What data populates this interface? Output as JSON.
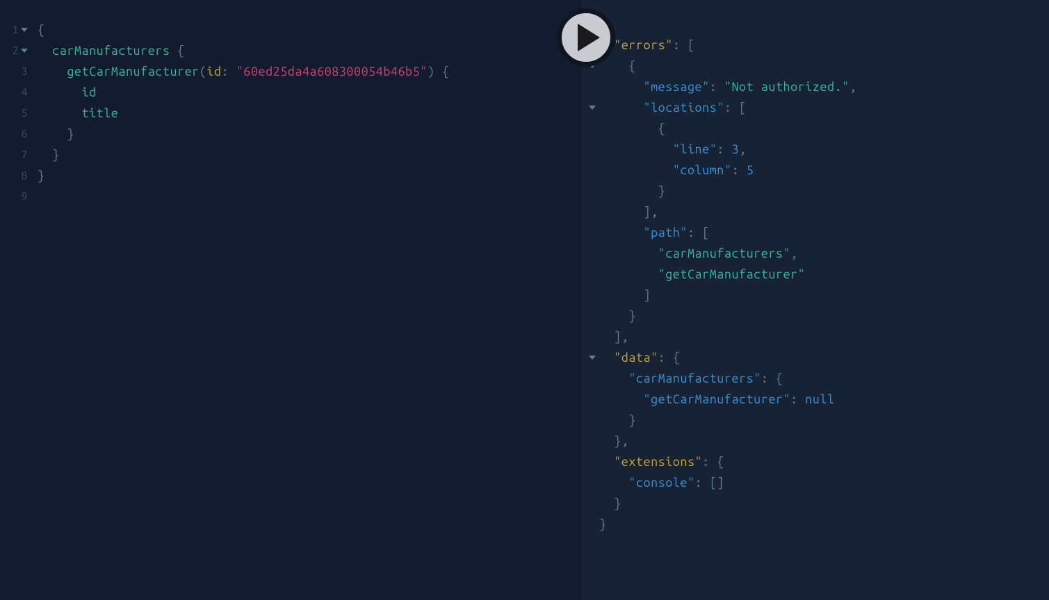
{
  "query": {
    "lines": [
      "1",
      "2",
      "3",
      "4",
      "5",
      "6",
      "7",
      "8",
      "9"
    ],
    "l1_open": "{",
    "l2_field": "carManufacturers",
    "l2_brace": " {",
    "l3_func": "getCarManufacturer",
    "l3_lp": "(",
    "l3_arg": "id",
    "l3_colon": ": ",
    "l3_val": "\"60ed25da4a608300054b46b5\"",
    "l3_rp_brace": ") {",
    "l4_field": "id",
    "l5_field": "title",
    "l6_close": "}",
    "l7_close": "}",
    "l8_close": "}"
  },
  "response": {
    "r1": "{",
    "r2_k": "\"errors\"",
    "r2_p": ": [",
    "r3": "{",
    "r4_k": "\"message\"",
    "r4_p": ": ",
    "r4_v": "\"Not authorized.\"",
    "r4_c": ",",
    "r5_k": "\"locations\"",
    "r5_p": ": [",
    "r6": "{",
    "r7_k": "\"line\"",
    "r7_p": ": ",
    "r7_v": "3",
    "r7_c": ",",
    "r8_k": "\"column\"",
    "r8_p": ": ",
    "r8_v": "5",
    "r9": "}",
    "r10": "],",
    "r11_k": "\"path\"",
    "r11_p": ": [",
    "r12_v": "\"carManufacturers\"",
    "r12_c": ",",
    "r13_v": "\"getCarManufacturer\"",
    "r14": "]",
    "r15": "}",
    "r16": "],",
    "r17_k": "\"data\"",
    "r17_p": ": {",
    "r18_k": "\"carManufacturers\"",
    "r18_p": ": {",
    "r19_k": "\"getCarManufacturer\"",
    "r19_p": ": ",
    "r19_v": "null",
    "r20": "}",
    "r21": "},",
    "r22_k": "\"extensions\"",
    "r22_p": ": {",
    "r23_k": "\"console\"",
    "r23_p": ": []",
    "r24": "}",
    "r25": "}"
  }
}
